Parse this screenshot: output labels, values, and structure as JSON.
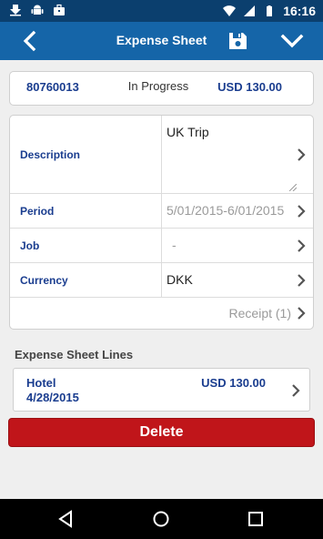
{
  "status_bar": {
    "time": "16:16",
    "left_icons": [
      "download-icon",
      "android-icon",
      "briefcase-icon"
    ],
    "right_icons": [
      "wifi-icon",
      "cell-signal-icon",
      "battery-icon"
    ]
  },
  "app_bar": {
    "title": "Expense Sheet",
    "back_icon": "chevron-left-icon",
    "save_icon": "save-icon",
    "confirm_icon": "chevron-down-icon"
  },
  "summary": {
    "number": "80760013",
    "status": "In Progress",
    "amount": "USD 130.00"
  },
  "form": {
    "description": {
      "label": "Description",
      "value": "UK Trip"
    },
    "period": {
      "label": "Period",
      "value": "5/01/2015-6/01/2015"
    },
    "job": {
      "label": "Job",
      "value": "-"
    },
    "currency": {
      "label": "Currency",
      "value": "DKK"
    },
    "receipt": {
      "label": "Receipt (1)"
    }
  },
  "lines": {
    "title": "Expense Sheet Lines",
    "items": [
      {
        "name": "Hotel",
        "date": "4/28/2015",
        "amount": "USD 130.00"
      }
    ]
  },
  "actions": {
    "delete_label": "Delete"
  },
  "colors": {
    "primary": "#1565a8",
    "status_bar": "#0b3f6e",
    "label": "#1a3d8f",
    "danger": "#c0151a"
  }
}
